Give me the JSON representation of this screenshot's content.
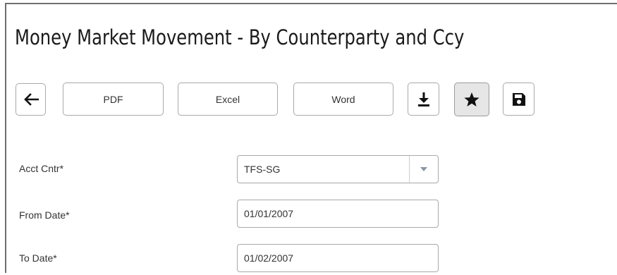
{
  "page": {
    "title": "Money Market Movement - By Counterparty and Ccy"
  },
  "toolbar": {
    "back_icon": "arrow-left-icon",
    "pdf_label": "PDF",
    "excel_label": "Excel",
    "word_label": "Word",
    "download_icon": "download-icon",
    "favorite_icon": "star-icon",
    "save_icon": "save-icon"
  },
  "form": {
    "acct_cntr": {
      "label": "Acct Cntr*",
      "value": "TFS-SG"
    },
    "from_date": {
      "label": "From Date*",
      "value": "01/01/2007"
    },
    "to_date": {
      "label": "To Date*",
      "value": "01/02/2007"
    }
  },
  "colors": {
    "border": "#a9a9a9",
    "frame": "#6f6f6f",
    "active_button_bg": "#e6e6e6",
    "text": "#333333"
  }
}
